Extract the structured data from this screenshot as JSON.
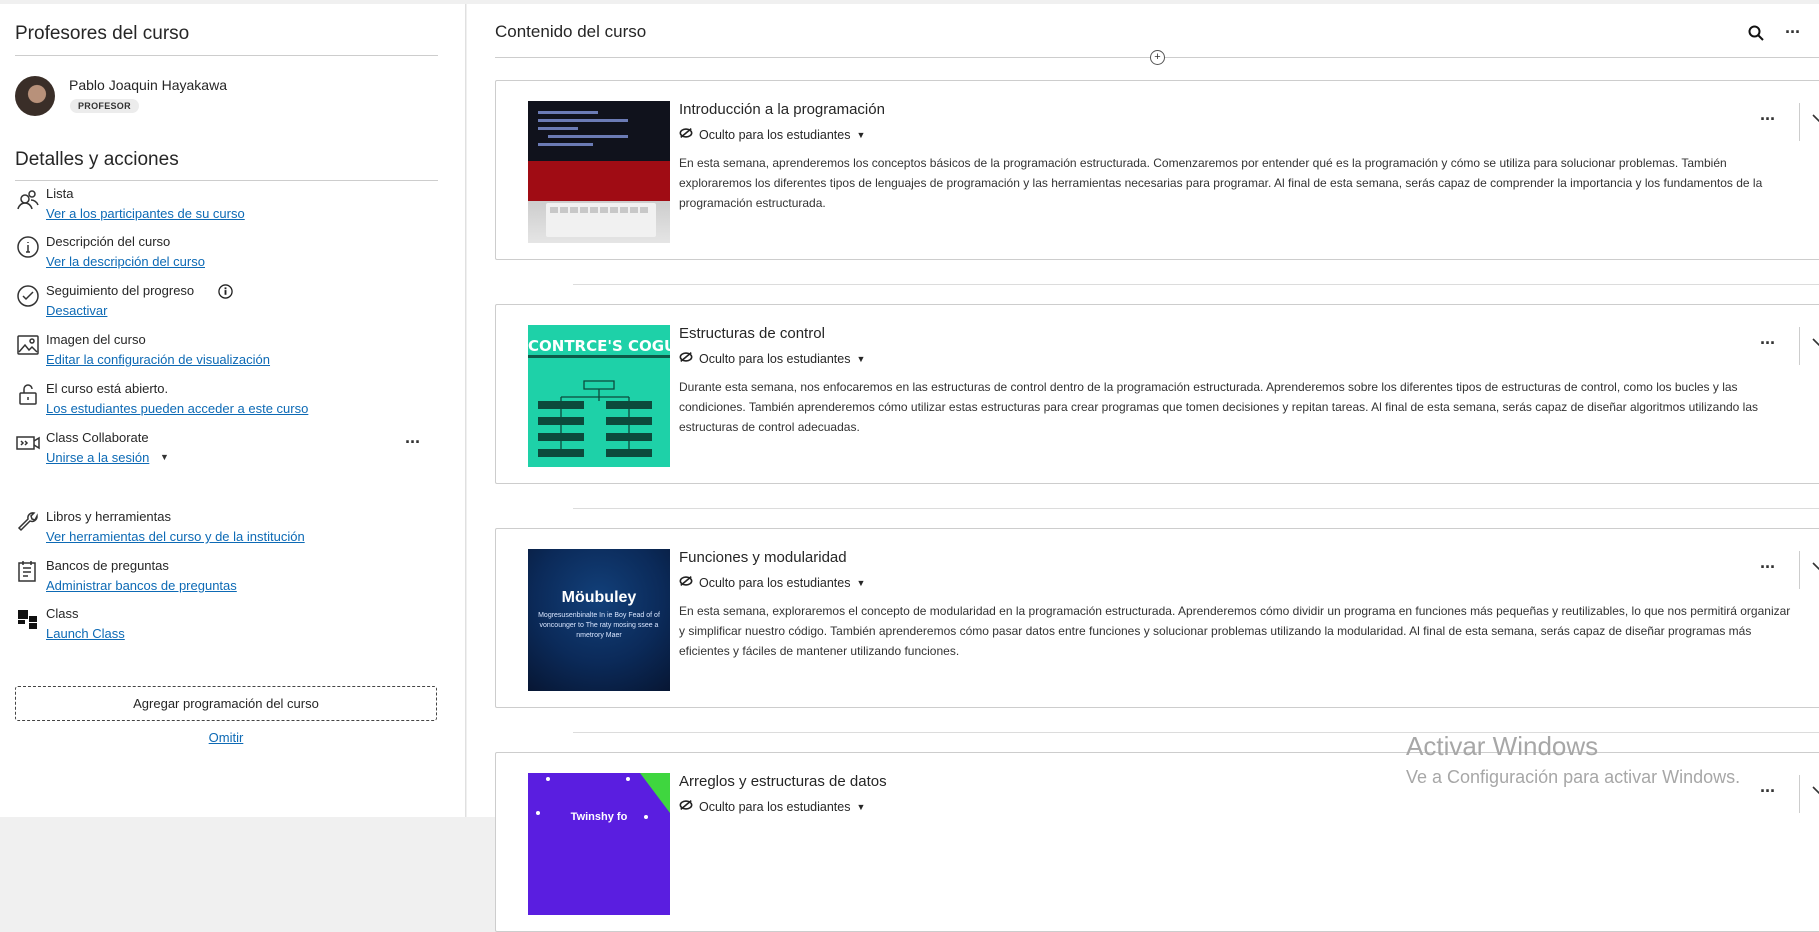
{
  "instructors": {
    "title": "Profesores del curso",
    "name": "Pablo Joaquin Hayakawa",
    "role": "PROFESOR"
  },
  "details": {
    "title": "Detalles y acciones",
    "items": [
      {
        "label": "Lista",
        "link": "Ver a los participantes de su curso",
        "icon": "roster-icon"
      },
      {
        "label": "Descripción del curso",
        "link": "Ver la descripción del curso",
        "icon": "info-icon"
      },
      {
        "label": "Seguimiento del progreso",
        "link": "Desactivar",
        "icon": "progress-check-icon"
      },
      {
        "label": "Imagen del curso",
        "link": "Editar la configuración de visualización",
        "icon": "image-icon"
      },
      {
        "label": "El curso está abierto.",
        "link": "Los estudiantes pueden acceder a este curso",
        "icon": "unlock-icon"
      },
      {
        "label": "Class Collaborate",
        "link": "Unirse a la sesión",
        "icon": "collaborate-icon"
      },
      {
        "label": "Libros y herramientas",
        "link": "Ver herramientas del curso y de la institución",
        "icon": "wrench-icon"
      },
      {
        "label": "Bancos de preguntas",
        "link": "Administrar bancos de preguntas",
        "icon": "question-bank-icon"
      },
      {
        "label": "Class",
        "link": "Launch Class",
        "icon": "class-icon"
      }
    ],
    "add_schedule": "Agregar programación del curso",
    "omit": "Omitir"
  },
  "main": {
    "title": "Contenido del curso",
    "cards": [
      {
        "title": "Introducción a la programación",
        "visibility": "Oculto para los estudiantes",
        "description": "En esta semana, aprenderemos los conceptos básicos de la programación estructurada. Comenzaremos por entender qué es la programación y cómo se utiliza para solucionar problemas. También exploraremos los diferentes tipos de lenguajes de programación y las herramientas necesarias para programar. Al final de esta semana, serás capaz de comprender la importancia y los fundamentos de la programación estructurada."
      },
      {
        "title": "Estructuras de control",
        "visibility": "Oculto para los estudiantes",
        "description": "Durante esta semana, nos enfocaremos en las estructuras de control dentro de la programación estructurada. Aprenderemos sobre los diferentes tipos de estructuras de control, como los bucles y las condiciones. También aprenderemos cómo utilizar estas estructuras para crear programas que tomen decisiones y repitan tareas. Al final de esta semana, serás capaz de diseñar algoritmos utilizando las estructuras de control adecuadas.",
        "thumb_text": "CONTRCE'S COGUTY"
      },
      {
        "title": "Funciones y modularidad",
        "visibility": "Oculto para los estudiantes",
        "description": "En esta semana, exploraremos el concepto de modularidad en la programación estructurada. Aprenderemos cómo dividir un programa en funciones más pequeñas y reutilizables, lo que nos permitirá organizar y simplificar nuestro código. También aprenderemos cómo pasar datos entre funciones y solucionar problemas utilizando la modularidad. Al final de esta semana, serás capaz de diseñar programas más eficientes y fáciles de mantener utilizando funciones.",
        "thumb_text": "Möubuley",
        "thumb_sub": "Mogresusenbinalte In ie Boy Fead of of voncounger to The raty mosing ssee a nmetrory Maer"
      },
      {
        "title": "Arreglos y estructuras de datos",
        "visibility": "Oculto para los estudiantes",
        "description": "",
        "thumb_text": "Twinshy fo"
      }
    ]
  },
  "watermark": {
    "line1": "Activar Windows",
    "line2": "Ve a Configuración para activar Windows."
  },
  "colors": {
    "link": "#0d6ab5",
    "card2_thumb": "#1ed1a8",
    "card3_thumb": "#0b2a59",
    "card4_thumb": "#5a1ee0"
  }
}
